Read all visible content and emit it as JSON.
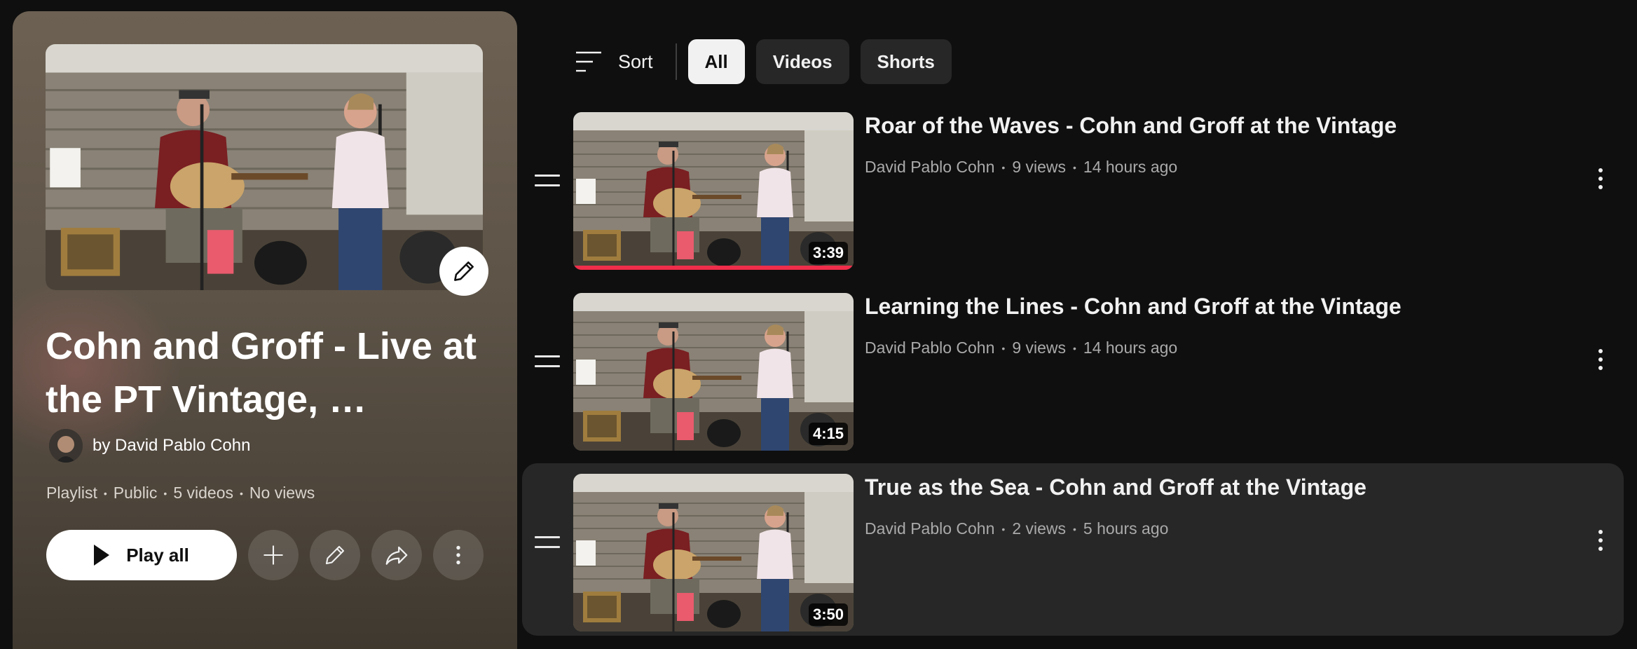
{
  "playlist": {
    "title": "Cohn and Groff - Live at the PT Vintage, …",
    "owner": "by David Pablo Cohn",
    "meta": [
      "Playlist",
      "Public",
      "5 videos",
      "No views"
    ],
    "play_all_label": "Play all",
    "icons": [
      "pencil-icon",
      "plus-icon",
      "pencil-icon",
      "share-icon",
      "more-vert-icon"
    ]
  },
  "filters": {
    "sort_label": "Sort",
    "chips": [
      "All",
      "Videos",
      "Shorts"
    ],
    "active": "All"
  },
  "videos": [
    {
      "title": "Roar of the Waves - Cohn and Groff at the Vintage",
      "channel": "David Pablo Cohn",
      "views": "9 views",
      "age": "14 hours ago",
      "duration": "3:39",
      "watched_fraction": 1.0
    },
    {
      "title": "Learning the Lines - Cohn and Groff at the Vintage",
      "channel": "David Pablo Cohn",
      "views": "9 views",
      "age": "14 hours ago",
      "duration": "4:15",
      "watched_fraction": 0
    },
    {
      "title": "True as the Sea - Cohn and Groff at the Vintage",
      "channel": "David Pablo Cohn",
      "views": "2 views",
      "age": "5 hours ago",
      "duration": "3:50",
      "watched_fraction": 0
    }
  ],
  "colors": {
    "background": "#0f0f0f",
    "chip": "#272727",
    "chip_active": "#f1f1f1",
    "progress": "#f02d4a",
    "secondary_text": "#aaaaaa"
  }
}
